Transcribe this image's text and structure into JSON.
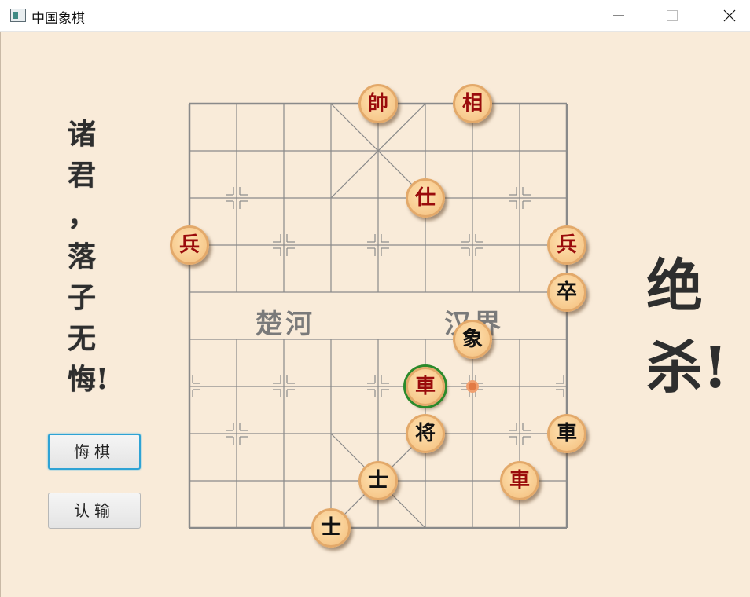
{
  "window": {
    "title": "中国象棋",
    "controls": [
      "minimize",
      "maximize",
      "close"
    ]
  },
  "slogan": [
    "诸",
    "君",
    "，",
    "落",
    "子",
    "无",
    "悔!"
  ],
  "buttons": {
    "undo": "悔棋",
    "resign": "认输"
  },
  "river": {
    "left": "楚河",
    "right": "汉界"
  },
  "verdict": [
    "绝",
    "杀!"
  ],
  "pieces": [
    {
      "char": "帥",
      "side": "red",
      "col": 4,
      "row": 0
    },
    {
      "char": "相",
      "side": "red",
      "col": 6,
      "row": 0
    },
    {
      "char": "仕",
      "side": "red",
      "col": 5,
      "row": 2
    },
    {
      "char": "兵",
      "side": "red",
      "col": 0,
      "row": 3
    },
    {
      "char": "兵",
      "side": "red",
      "col": 8,
      "row": 3
    },
    {
      "char": "卒",
      "side": "black",
      "col": 8,
      "row": 4
    },
    {
      "char": "象",
      "side": "black",
      "col": 6,
      "row": 5
    },
    {
      "char": "車",
      "side": "red",
      "col": 5,
      "row": 6,
      "selected": true
    },
    {
      "char": "将",
      "side": "black",
      "col": 5,
      "row": 7
    },
    {
      "char": "車",
      "side": "black",
      "col": 8,
      "row": 7
    },
    {
      "char": "士",
      "side": "black",
      "col": 4,
      "row": 8
    },
    {
      "char": "車",
      "side": "red",
      "col": 7,
      "row": 8
    },
    {
      "char": "士",
      "side": "black",
      "col": 3,
      "row": 9
    }
  ],
  "last_move_marker": {
    "col": 6,
    "row": 6
  },
  "colors": {
    "background": "#f9ebd9",
    "board_line": "#8a8a8a",
    "red_piece_text": "#9a0b0b",
    "black_piece_text": "#111111",
    "selection_ring": "#2b8a2b",
    "move_marker": "#e27a45"
  }
}
